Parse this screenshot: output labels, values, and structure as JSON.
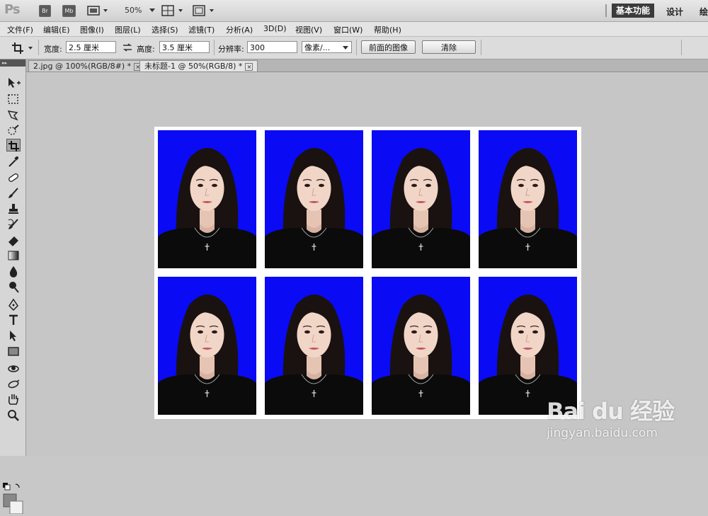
{
  "app": {
    "logo": "Ps",
    "buttons": [
      "Br",
      "Mb"
    ],
    "zoom": "50%",
    "workspaces": [
      "基本功能",
      "设计",
      "绘"
    ]
  },
  "menu": [
    "文件(F)",
    "编辑(E)",
    "图像(I)",
    "图层(L)",
    "选择(S)",
    "滤镜(T)",
    "分析(A)",
    "3D(D)",
    "视图(V)",
    "窗口(W)",
    "帮助(H)"
  ],
  "options": {
    "width_label": "宽度:",
    "width_value": "2.5 厘米",
    "height_label": "高度:",
    "height_value": "3.5 厘米",
    "resolution_label": "分辨率:",
    "resolution_value": "300",
    "unit_value": "像素/...",
    "front_image_button": "前面的图像",
    "clear_button": "清除"
  },
  "tabs": [
    {
      "label": "2.jpg @ 100%(RGB/8#) *",
      "close": "×",
      "active": false
    },
    {
      "label": "未标题-1 @ 50%(RGB/8) *",
      "close": "×",
      "active": true
    }
  ],
  "document": {
    "photo_count": 8,
    "grid": "2 rows × 4 columns",
    "photo_background": "#0a0af5",
    "paper_color": "#ffffff"
  },
  "watermark": {
    "main": "Bai du 经验",
    "sub": "jingyan.baidu.com"
  }
}
